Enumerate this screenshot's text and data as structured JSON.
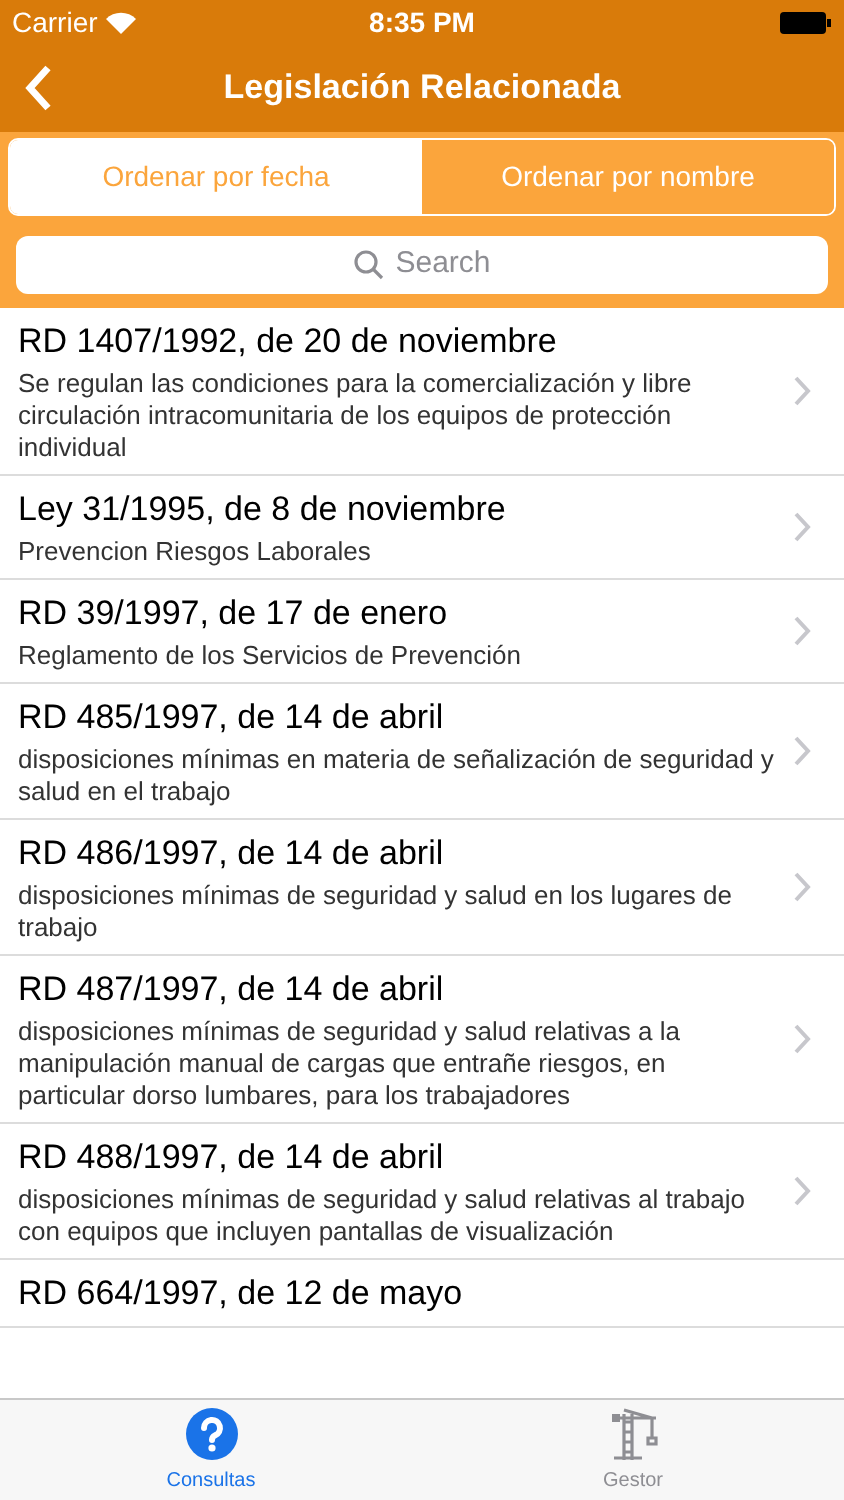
{
  "status_bar": {
    "carrier": "Carrier",
    "time": "8:35 PM"
  },
  "nav": {
    "title": "Legislación Relacionada"
  },
  "segments": [
    {
      "label": "Ordenar por fecha",
      "selected": false
    },
    {
      "label": "Ordenar por nombre",
      "selected": true
    }
  ],
  "search": {
    "placeholder": "Search"
  },
  "items": [
    {
      "title": "RD 1407/1992, de 20 de noviembre",
      "subtitle": "Se regulan las condiciones para la comercialización y libre circulación intracomunitaria de los equipos de protección individual"
    },
    {
      "title": "Ley 31/1995, de 8 de noviembre",
      "subtitle": "Prevencion Riesgos Laborales"
    },
    {
      "title": "RD 39/1997, de 17 de enero",
      "subtitle": "Reglamento de los Servicios de Prevención"
    },
    {
      "title": "RD 485/1997, de 14 de abril",
      "subtitle": "disposiciones mínimas en materia de señalización de seguridad y salud en el trabajo"
    },
    {
      "title": "RD 486/1997, de 14 de abril",
      "subtitle": "disposiciones mínimas de seguridad y salud en los lugares de trabajo"
    },
    {
      "title": "RD 487/1997, de 14 de abril",
      "subtitle": "disposiciones mínimas de seguridad y salud relativas a la manipulación manual de cargas que entrañe riesgos, en particular dorso lumbares, para los trabajadores"
    },
    {
      "title": "RD 488/1997, de 14 de abril",
      "subtitle": "disposiciones mínimas de seguridad y salud relativas al trabajo con equipos que incluyen pantallas de visualización"
    },
    {
      "title": "RD 664/1997, de 12 de mayo"
    }
  ],
  "tab_bar": [
    {
      "label": "Consultas",
      "kind": "help",
      "selected": true
    },
    {
      "label": "Gestor",
      "kind": "crane",
      "selected": false
    }
  ]
}
